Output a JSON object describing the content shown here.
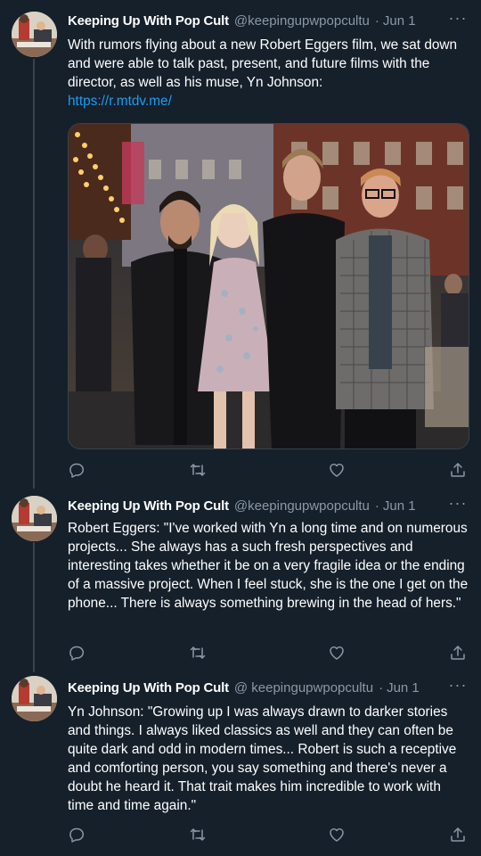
{
  "tweets": [
    {
      "name": "Keeping Up With Pop Culture",
      "name_display": "Keeping Up With Pop Cult",
      "handle": "@keepingupwpopculture",
      "handle_display": "@keepingupwpopcultu",
      "date": "Jun 1",
      "text": "With rumors flying about a new Robert Eggers film, we sat down and were able to talk past, present, and future films with the director, as well as his muse, Yn Johnson:",
      "link": "https://r.mtdv.me/",
      "has_photo": true
    },
    {
      "name": "Keeping Up With Pop Culture",
      "name_display": "Keeping Up With Pop Cult",
      "handle": "@keepingupwpopculture",
      "handle_display": "@keepingupwpopcultu",
      "date": "Jun 1",
      "text": "Robert Eggers: \"I've worked with Yn a long time and on numerous projects... She always has a such fresh perspectives and interesting takes whether it be on a very fragile idea or the ending of a massive project. When I feel stuck, she is the one I get on the phone... There is always something brewing in the head of hers.\""
    },
    {
      "name": "Keeping Up With Pop Culture",
      "name_display": "Keeping Up With Pop Cult",
      "handle": "@ keepingupwpopculture",
      "handle_display": "@ keepingupwpopcultu",
      "date": "Jun 1",
      "text": "Yn Johnson: \"Growing up I was always drawn to darker stories and things. I always liked classics as well and they can often be quite dark and odd in modern times... Robert is such a receptive and comforting person, you say something and there's never a doubt he heard it. That trait makes him incredible to work with time and time again.\""
    }
  ],
  "separator": "·",
  "more_glyph": "···",
  "action_icons": [
    "reply-icon",
    "retweet-icon",
    "like-icon",
    "share-icon"
  ],
  "colors": {
    "background": "#15202b",
    "text": "#ffffff",
    "secondary": "#8b98a5",
    "link": "#1d9bf0",
    "border": "#38444d"
  }
}
